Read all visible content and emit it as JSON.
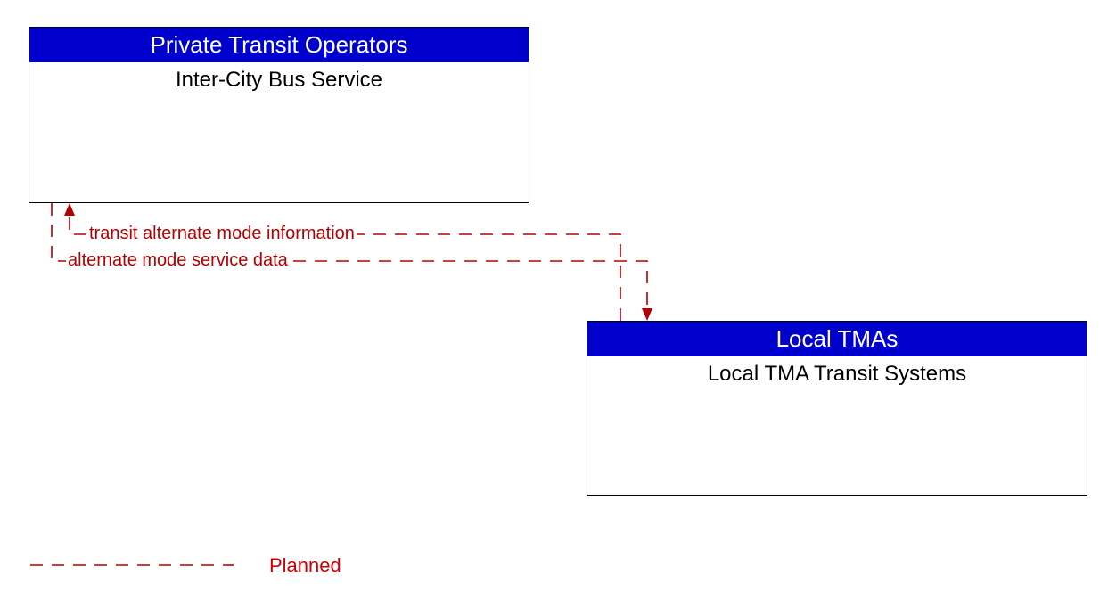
{
  "entities": {
    "top": {
      "header": "Private Transit Operators",
      "body": "Inter-City Bus Service"
    },
    "bottom": {
      "header": "Local TMAs",
      "body": "Local TMA Transit Systems"
    }
  },
  "flows": {
    "flow1": "transit alternate mode information",
    "flow2": "alternate mode service data"
  },
  "legend": {
    "planned": "Planned"
  }
}
